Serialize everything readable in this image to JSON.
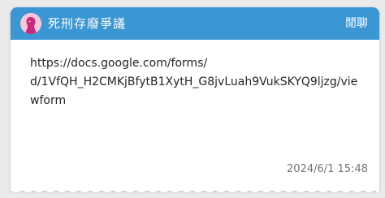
{
  "header": {
    "board_name": "死刑存廢爭議",
    "action_label": "閒聊",
    "avatar_icon": "board-avatar-icon",
    "colors": {
      "header_bg": "#3b97d3",
      "header_text": "#ffffff",
      "avatar_bg": "#f7c8dc",
      "avatar_figure": "#c42c79"
    }
  },
  "post": {
    "body": "https://docs.google.com/forms/\nd/1VfQH_H2CMKjBfytB1XytH_G8jvLuah9VukSKYQ9ljzg/viewform",
    "timestamp": "2024/6/1 15:48"
  }
}
